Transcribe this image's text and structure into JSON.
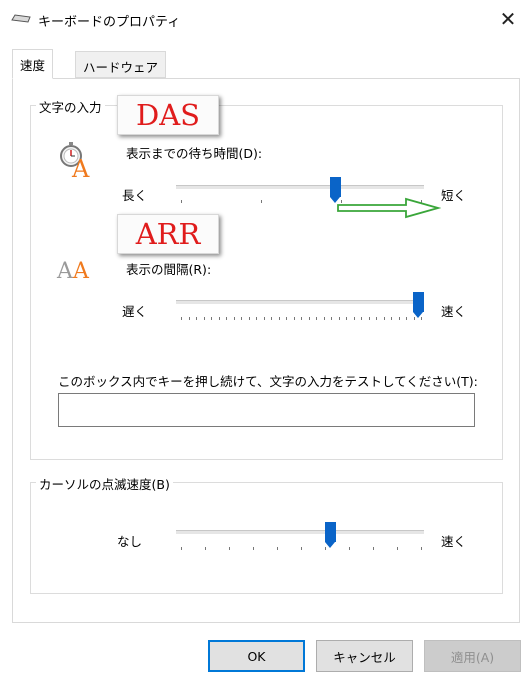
{
  "window": {
    "title": "キーボードのプロパティ",
    "icon": "keyboard-icon",
    "close_glyph": "✕"
  },
  "tabs": [
    {
      "label": "速度",
      "active": true
    },
    {
      "label": "ハードウェア",
      "active": false
    }
  ],
  "repeat_group": {
    "label": "文字の入力",
    "delay": {
      "label": "表示までの待ち時間(D):",
      "left": "長く",
      "right": "短く",
      "level": 0.65
    },
    "rate": {
      "label": "表示の間隔(R):",
      "left": "遅く",
      "right": "速く",
      "level": 1.0
    },
    "test_label": "このボックス内でキーを押し続けて、文字の入力をテストしてください(T):",
    "test_value": ""
  },
  "cursor_group": {
    "label": "カーソルの点滅速度(B)",
    "left": "なし",
    "right": "速く",
    "level": 0.63
  },
  "buttons": {
    "ok": "OK",
    "cancel": "キャンセル",
    "apply": "適用(A)"
  },
  "annotations": {
    "das": "DAS",
    "arr": "ARR",
    "text_color": "#e01c1c",
    "arrow_color": "#3aa63a"
  },
  "colors": {
    "accent": "#0a64c8",
    "icon_orange": "#f07a1e",
    "icon_gray": "#9a9a9a"
  }
}
